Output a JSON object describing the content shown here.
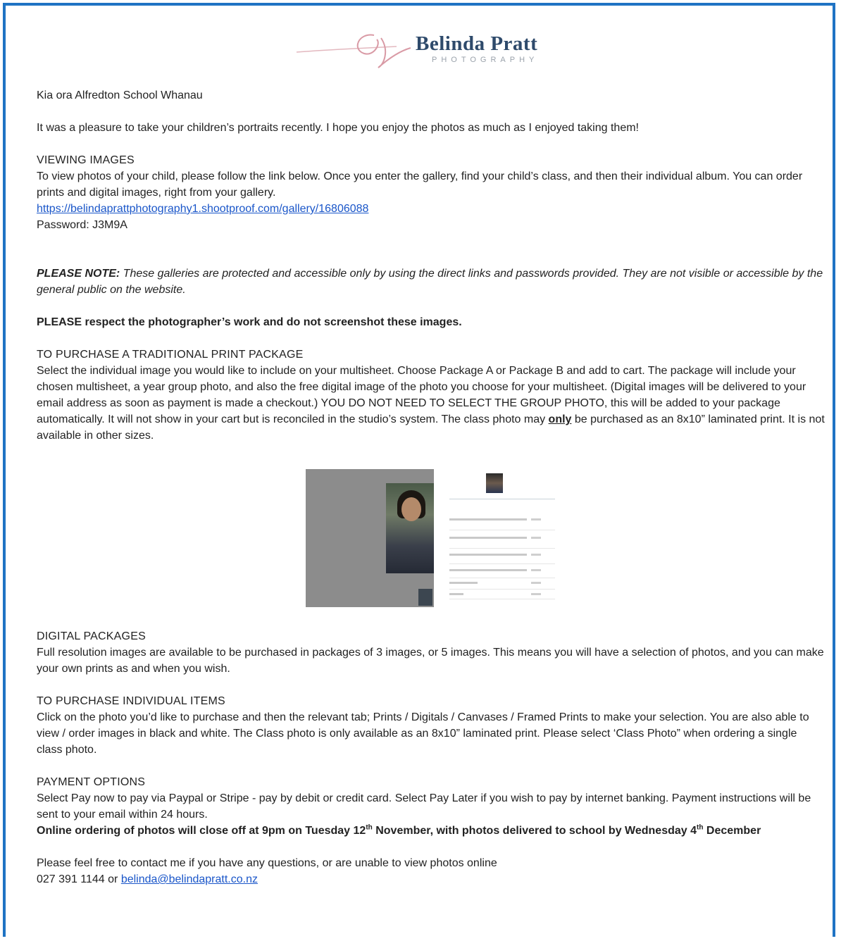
{
  "logo": {
    "name": "Belinda Pratt",
    "sub": "PHOTOGRAPHY"
  },
  "greeting": "Kia ora Alfredton School Whanau",
  "intro": "It was a pleasure to take your children’s portraits recently.  I hope you enjoy the photos as much as I enjoyed taking them!",
  "viewing": {
    "heading": "VIEWING IMAGES",
    "body": "To view photos of your child, please follow the link below. Once you enter the gallery, find your child’s class, and then their individual album. You can order prints and digital images, right from your gallery.",
    "link": "https://belindaprattphotography1.shootproof.com/gallery/16806088",
    "password": "Password: J3M9A"
  },
  "note": {
    "label": "PLEASE NOTE:",
    "text": " These galleries are protected and accessible only by using the direct links and passwords provided. They are not visible or accessible by the general public on the website."
  },
  "respect": "PLEASE respect the photographer’s work and do not screenshot these images.",
  "traditional": {
    "heading": "TO PURCHASE A TRADITIONAL PRINT PACKAGE",
    "body_a": "Select the individual image you would like to include on your multisheet. Choose Package A or Package B and add to cart. The package will include your chosen multisheet, a year group photo, and also the free digital image of the photo you choose for your multisheet. (Digital images will be delivered to your email address as soon as payment is made a checkout.) YOU DO NOT NEED TO SELECT THE GROUP PHOTO, this will be added to your package automatically. It will not show in your cart but is reconciled in the studio’s system. The class photo may ",
    "body_only": "only",
    "body_b": " be purchased as an 8x10” laminated print. It is not available in other sizes."
  },
  "digital": {
    "heading": "DIGITAL PACKAGES",
    "body": "Full resolution images are available to be purchased in packages of 3 images, or 5 images. This means you will have a selection of photos, and you can make your own prints as and when you wish."
  },
  "individual": {
    "heading": "TO PURCHASE INDIVIDUAL ITEMS",
    "body": "Click on the photo you’d like to purchase and then the relevant tab; Prints / Digitals / Canvases / Framed Prints to make your selection. You are also able to view / order images in black and white. The Class photo is only available as an 8x10” laminated print. Please select ‘Class Photo” when ordering a single class photo."
  },
  "payment": {
    "heading": "PAYMENT OPTIONS",
    "body": "Select Pay now to pay via Paypal  or Stripe - pay by debit or credit card. Select Pay Later if you wish to pay by internet banking. Payment instructions will be sent to your email within 24 hours.",
    "close_a": "Online ordering of photos will close off at 9pm on Tuesday 12",
    "close_sup1": "th",
    "close_b": " November, with photos delivered to school by Wednesday 4",
    "close_sup2": "th",
    "close_c": " December"
  },
  "contact": {
    "text": "Please feel free to contact me if you have any questions, or are unable to view photos online",
    "phone": "027 391 1144 or ",
    "email": "belinda@belindapratt.co.nz"
  }
}
